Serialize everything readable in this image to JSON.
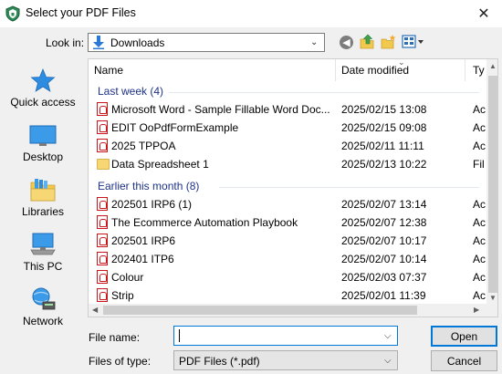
{
  "window": {
    "title": "Select your PDF Files",
    "close_glyph": "✕",
    "app_icon": "shield-icon"
  },
  "lookin": {
    "label": "Look in:",
    "value": "Downloads",
    "icon": "download-arrow-icon"
  },
  "nav": {
    "back_glyph": "◀",
    "icons": [
      "back-icon",
      "up-folder-icon",
      "new-folder-icon",
      "view-menu-icon"
    ]
  },
  "places": [
    {
      "label": "Quick access",
      "icon": "star-icon"
    },
    {
      "label": "Desktop",
      "icon": "desktop-icon"
    },
    {
      "label": "Libraries",
      "icon": "libraries-icon"
    },
    {
      "label": "This PC",
      "icon": "pc-icon"
    },
    {
      "label": "Network",
      "icon": "network-icon"
    }
  ],
  "columns": {
    "name": "Name",
    "date": "Date modified",
    "type": "Ty",
    "sort_glyph": "⌄"
  },
  "groups": [
    {
      "label": "Last week (4)",
      "files": [
        {
          "name": "Microsoft Word - Sample Fillable Word Doc...",
          "date": "2025/02/15 13:08",
          "type": "Ac",
          "kind": "pdf"
        },
        {
          "name": "EDIT OoPdfFormExample",
          "date": "2025/02/15 09:08",
          "type": "Ac",
          "kind": "pdf"
        },
        {
          "name": "2025 TPPOA",
          "date": "2025/02/11 11:11",
          "type": "Ac",
          "kind": "pdf"
        },
        {
          "name": "Data Spreadsheet 1",
          "date": "2025/02/13 10:22",
          "type": "Fil",
          "kind": "folder"
        }
      ]
    },
    {
      "label": "Earlier this month (8)",
      "files": [
        {
          "name": "202501 IRP6 (1)",
          "date": "2025/02/07 13:14",
          "type": "Ac",
          "kind": "pdf"
        },
        {
          "name": "The Ecommerce Automation Playbook",
          "date": "2025/02/07 12:38",
          "type": "Ac",
          "kind": "pdf"
        },
        {
          "name": "202501 IRP6",
          "date": "2025/02/07 10:17",
          "type": "Ac",
          "kind": "pdf"
        },
        {
          "name": "202401 ITP6",
          "date": "2025/02/07 10:14",
          "type": "Ac",
          "kind": "pdf"
        },
        {
          "name": "Colour",
          "date": "2025/02/03 07:37",
          "type": "Ac",
          "kind": "pdf"
        },
        {
          "name": "Strip",
          "date": "2025/02/01 11:39",
          "type": "Ac",
          "kind": "pdf"
        }
      ]
    }
  ],
  "scroll": {
    "up": "▲",
    "down": "▼",
    "left": "◀",
    "right": "▶"
  },
  "filename": {
    "label": "File name:",
    "value": "",
    "chev": "⌵"
  },
  "filetype": {
    "label": "Files of type:",
    "value": "PDF Files (*.pdf)",
    "chev": "⌵"
  },
  "buttons": {
    "open": "Open",
    "cancel": "Cancel"
  },
  "colors": {
    "accent": "#0078d7",
    "group_text": "#1e3287",
    "pdf_red": "#c8161d"
  }
}
